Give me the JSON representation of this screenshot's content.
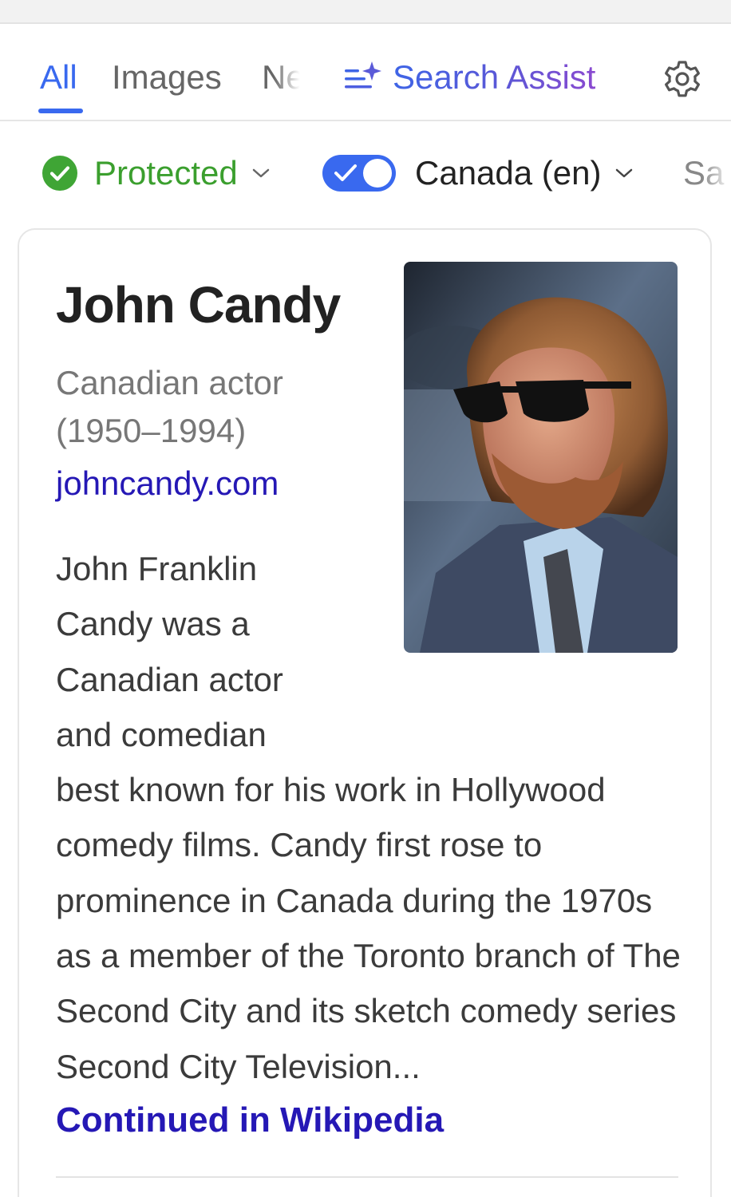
{
  "tabs": {
    "all": "All",
    "images": "Images",
    "news_truncated": "Ne",
    "search_assist": "Search Assist",
    "settings_icon": "gear-icon",
    "active_color": "#3969ef"
  },
  "filters": {
    "safe_search": "Protected",
    "safe_search_icon": "check-circle-icon",
    "safe_search_color": "#3b9f2e",
    "region_toggle_on": true,
    "region": "Canada (en)",
    "next_filter_truncated": "Sa"
  },
  "knowledge_panel": {
    "title": "John Candy",
    "subtitle": "Canadian actor (1950–1994)",
    "website": "johncandy.com",
    "description": "John Franklin Candy was a Canadian actor and comedian best known for his work in Hollywood comedy films. Candy first rose to prominence in Canada during the 1970s as a member of the Toronto branch of The Second City and its sketch comedy series Second City Television...",
    "source_link": "Continued in Wikipedia",
    "link_color": "#2518b5"
  }
}
